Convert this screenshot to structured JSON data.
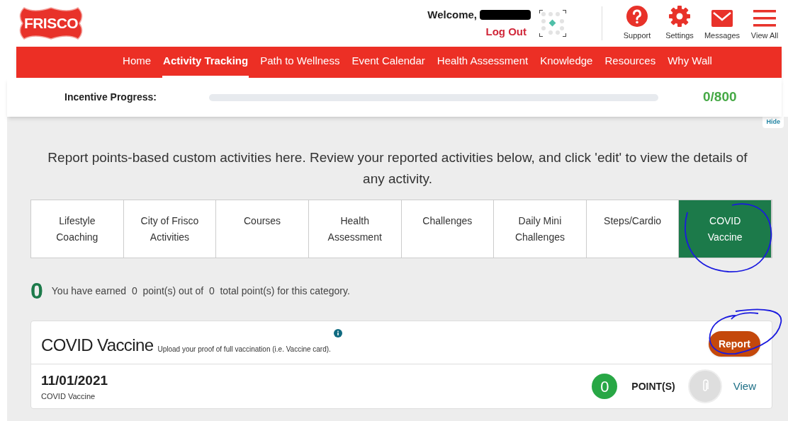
{
  "logo": {
    "text": "FRISCO"
  },
  "user": {
    "welcome": "Welcome,",
    "logout": "Log Out"
  },
  "header_icons": [
    {
      "kind": "support",
      "label": "Support"
    },
    {
      "kind": "settings",
      "label": "Settings"
    },
    {
      "kind": "messages",
      "label": "Messages"
    },
    {
      "kind": "menu",
      "label": "View All"
    }
  ],
  "nav": [
    {
      "label": "Home",
      "selected": false
    },
    {
      "label": "Activity Tracking",
      "selected": true
    },
    {
      "label": "Path to Wellness",
      "selected": false
    },
    {
      "label": "Event Calendar",
      "selected": false
    },
    {
      "label": "Health Assessment",
      "selected": false
    },
    {
      "label": "Knowledge",
      "selected": false
    },
    {
      "label": "Resources",
      "selected": false
    },
    {
      "label": "Why Wall",
      "selected": false
    }
  ],
  "incentive": {
    "label": "Incentive Progress:",
    "level": 0,
    "reading": "0/800",
    "hide": "Hide"
  },
  "intro": "Report points-based custom activities here. Review your reported activities below, and click 'edit' to view the details of any activity.",
  "categories": [
    {
      "label": "Lifestyle Coaching",
      "selected": false
    },
    {
      "label": "City of Frisco Activities",
      "selected": false
    },
    {
      "label": "Courses",
      "selected": false
    },
    {
      "label": "Health Assessment",
      "selected": false
    },
    {
      "label": "Challenges",
      "selected": false
    },
    {
      "label": "Daily Mini Challenges",
      "selected": false
    },
    {
      "label": "Steps/Cardio",
      "selected": false
    },
    {
      "label": "COVID Vaccine",
      "selected": true
    }
  ],
  "summary": {
    "big": "0",
    "text": "You have earned  0  point(s) out of  0  total point(s) for this category."
  },
  "activity": {
    "title": "COVID Vaccine",
    "description": "Upload your proof of full vaccination (i.e. Vaccine card).",
    "button": "Report",
    "entries": [
      {
        "date": "11/01/2021",
        "name": "COVID Vaccine",
        "points": "0",
        "points_label": "POINT(S)",
        "link": "View"
      }
    ]
  }
}
